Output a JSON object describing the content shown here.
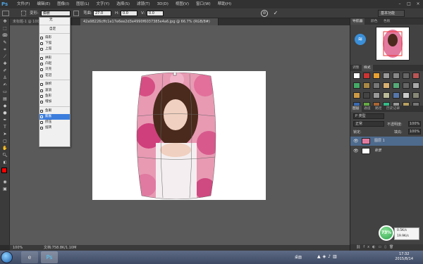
{
  "app": {
    "logo": "Ps"
  },
  "menu": [
    "文件(F)",
    "编辑(E)",
    "图像(I)",
    "图层(L)",
    "文字(Y)",
    "选择(S)",
    "滤镜(T)",
    "3D(D)",
    "视图(V)",
    "窗口(W)",
    "帮助(H)"
  ],
  "options": {
    "warp_label": "变形:",
    "warp_value": "膨胀",
    "bend_label": "弯曲:",
    "bend_value": "27.0",
    "h_label": "H:",
    "h_value": "0.0",
    "v_label": "V:",
    "v_value": "0.0",
    "workspace": "基本功能"
  },
  "doc_tabs": [
    {
      "label": "未标题-1 @ 100..."
    },
    {
      "label": "42a98226cffc1e17e6ee2d3e4990f6037385e4a6.jpg @ 66.7% (RGB/8#)"
    }
  ],
  "warp_menu": {
    "items": [
      {
        "label": "无",
        "type": "head"
      },
      {
        "label": "自定",
        "type": "head"
      },
      {
        "label": "扇形"
      },
      {
        "label": "下弧"
      },
      {
        "label": "上弧"
      },
      {
        "label": "拱形"
      },
      {
        "label": "凸起"
      },
      {
        "label": "贝壳"
      },
      {
        "label": "花冠"
      },
      {
        "label": "旗帜"
      },
      {
        "label": "波浪"
      },
      {
        "label": "鱼形"
      },
      {
        "label": "增加"
      },
      {
        "label": "鱼眼"
      },
      {
        "label": "膨胀",
        "selected": true
      },
      {
        "label": "挤压"
      },
      {
        "label": "扭转"
      }
    ]
  },
  "status": {
    "zoom": "100%",
    "doc": "文档:758.8K/1.10M"
  },
  "panels": {
    "navigator_tabs": [
      "导航器",
      "颜色",
      "色板"
    ],
    "styles_tabs": [
      "调整",
      "样式"
    ],
    "layers_tabs": [
      "图层",
      "通道",
      "路径",
      "历史记录"
    ],
    "kind_label": "P 类型",
    "blend_mode": "正常",
    "opacity_label": "不透明度:",
    "opacity": "100%",
    "lock_label": "锁定:",
    "fill_label": "填充:",
    "fill": "100%",
    "layers": [
      {
        "name": "图层 1",
        "selected": true
      },
      {
        "name": "背景",
        "selected": false
      }
    ]
  },
  "network": {
    "percent": "73%",
    "up": "0.5K/s",
    "down": "19.9K/s"
  },
  "taskbar": {
    "tray_label": "桌面",
    "time": "17:32",
    "date": "2015/8/14"
  },
  "colors": {
    "foreground": "#ff0000",
    "background": "#ffffff",
    "accent": "#3b7ddd"
  }
}
